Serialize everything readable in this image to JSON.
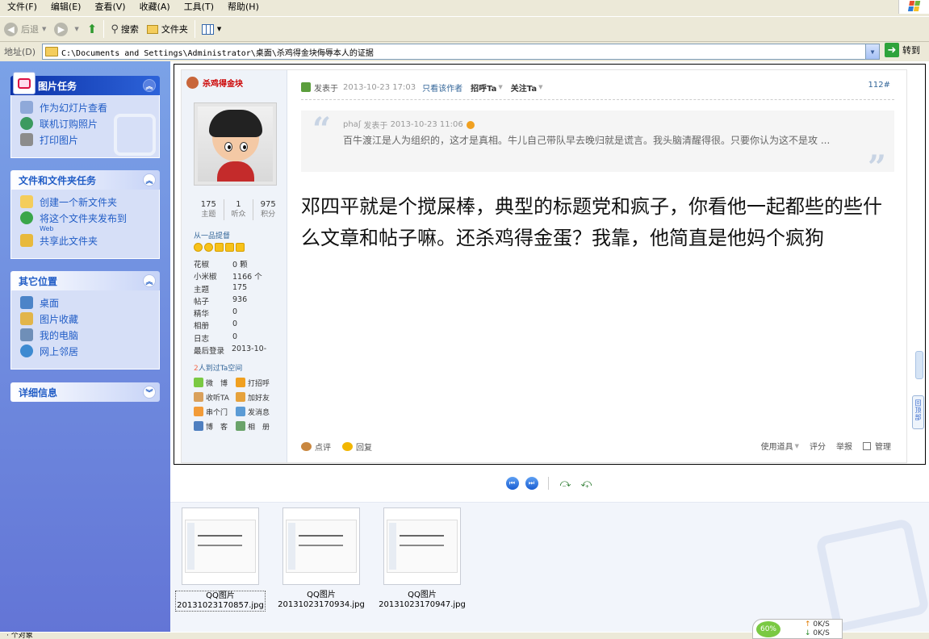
{
  "menu": [
    "文件(F)",
    "编辑(E)",
    "查看(V)",
    "收藏(A)",
    "工具(T)",
    "帮助(H)"
  ],
  "toolbar": {
    "back": "后退",
    "search": "搜索",
    "folders": "文件夹"
  },
  "address": {
    "label": "地址(D)",
    "path": "C:\\Documents and Settings\\Administrator\\桌面\\杀鸡得金块侮辱本人的证据",
    "go": "转到"
  },
  "sidebar": {
    "picture_tasks": {
      "title": "图片任务",
      "items": [
        "作为幻灯片查看",
        "联机订购照片",
        "打印图片"
      ]
    },
    "file_tasks": {
      "title": "文件和文件夹任务",
      "items": [
        "创建一个新文件夹",
        "将这个文件夹发布到",
        "共享此文件夹"
      ],
      "publish_sub": "Web"
    },
    "other_places": {
      "title": "其它位置",
      "items": [
        "桌面",
        "图片收藏",
        "我的电脑",
        "网上邻居"
      ]
    },
    "details": {
      "title": "详细信息"
    }
  },
  "post": {
    "username": "杀鸡得金块",
    "stats": [
      {
        "value": "175",
        "label": "主题"
      },
      {
        "value": "1",
        "label": "听众"
      },
      {
        "value": "975",
        "label": "积分"
      }
    ],
    "rank": "从一品提督",
    "info": [
      {
        "k": "花椒",
        "v": "0 颗"
      },
      {
        "k": "小米椒",
        "v": "1166 个"
      },
      {
        "k": "主题",
        "v": "175"
      },
      {
        "k": "帖子",
        "v": "936"
      },
      {
        "k": "精华",
        "v": "0"
      },
      {
        "k": "相册",
        "v": "0"
      },
      {
        "k": "日志",
        "v": "0"
      },
      {
        "k": "最后登录",
        "v": "2013-10-"
      }
    ],
    "visits_count": "2",
    "visits_text": "人到过Ta空间",
    "links": [
      "微　博",
      "打招呼",
      "收听TA",
      "加好友",
      "串个门",
      "发消息",
      "博　客",
      "相　册"
    ],
    "header": {
      "posted": "发表于",
      "time": "2013-10-23 17:03",
      "only_author": "只看该作者",
      "greet": "招呼Ta",
      "follow": "关注Ta",
      "floor": "112#"
    },
    "quote": {
      "author": "phaʃ",
      "posted": "发表于",
      "time": "2013-10-23 11:06",
      "text": "百牛渡江是人为组织的，这才是真相。牛儿自己带队早去晚归就是谎言。我头脑清醒得很。只要你认为这不是攻 ..."
    },
    "body": "邓四平就是个搅屎棒，典型的标题党和疯子，你看他一起都些的些什么文章和帖子嘛。还杀鸡得金蛋？我靠，他简直是他妈个疯狗",
    "footer": {
      "comment": "点评",
      "reply": "回复",
      "tools": "使用道具",
      "rate": "评分",
      "report": "举报",
      "manage": "管理"
    },
    "back_top": "回顶部"
  },
  "thumbnails": [
    {
      "name": "QQ图片",
      "file": "20131023170857.jpg",
      "selected": true
    },
    {
      "name": "QQ图片",
      "file": "20131023170934.jpg",
      "selected": false
    },
    {
      "name": "QQ图片",
      "file": "20131023170947.jpg",
      "selected": false
    }
  ],
  "status": {
    "left": "· 个对象",
    "net_percent": "60%",
    "up": "0K/S",
    "down": "0K/S"
  }
}
